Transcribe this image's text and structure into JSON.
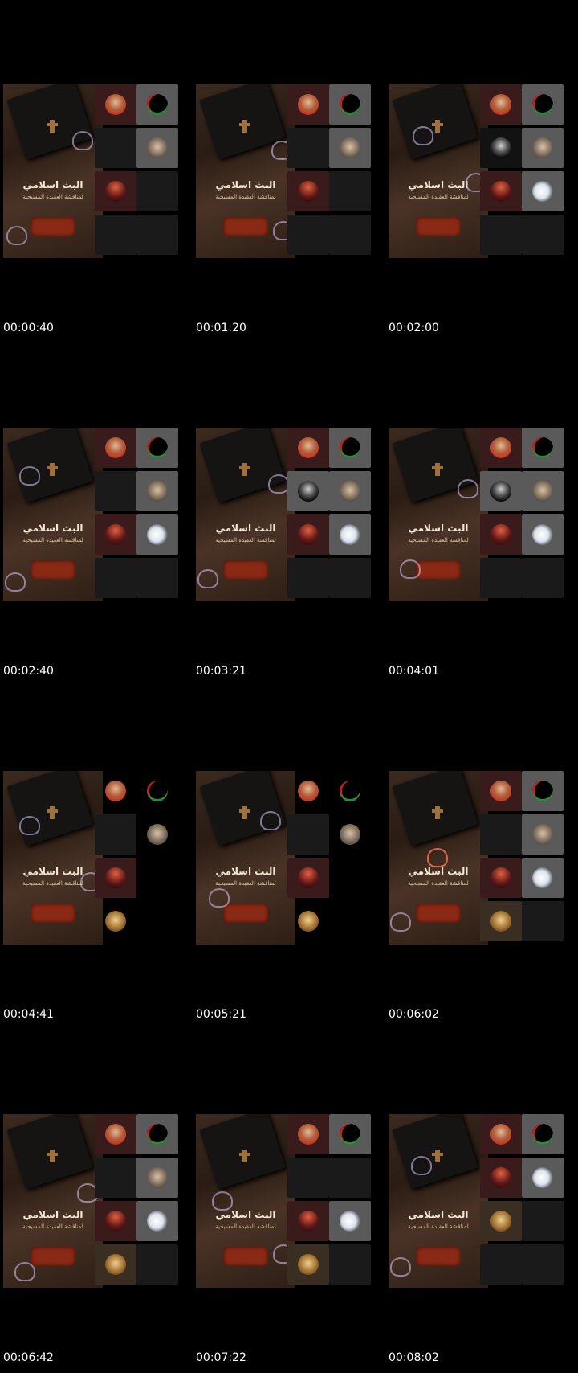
{
  "poster": {
    "title": "البث اسلامي",
    "subtitle": "لمناقشة العقيدة المسيحية"
  },
  "frames": [
    {
      "timestamp": "00:00:40"
    },
    {
      "timestamp": "00:01:20"
    },
    {
      "timestamp": "00:02:00"
    },
    {
      "timestamp": "00:02:40"
    },
    {
      "timestamp": "00:03:21"
    },
    {
      "timestamp": "00:04:01"
    },
    {
      "timestamp": "00:04:41"
    },
    {
      "timestamp": "00:05:21"
    },
    {
      "timestamp": "00:06:02"
    },
    {
      "timestamp": "00:06:42"
    },
    {
      "timestamp": "00:07:22"
    },
    {
      "timestamp": "00:08:02"
    }
  ],
  "colors": {
    "background": "#000000",
    "timestamp_text": "#ffffff",
    "poster_wood": "#3b2a1f",
    "seal_red": "#8a2a16"
  },
  "icons": [
    "heart-bubble-icon",
    "cross-icon",
    "book-icon"
  ]
}
